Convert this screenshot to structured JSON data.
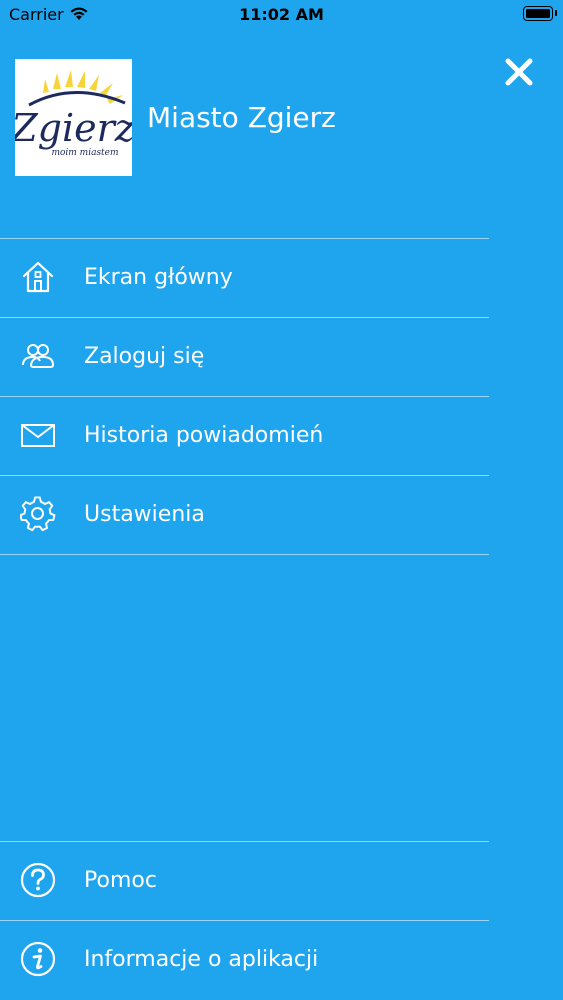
{
  "status_bar": {
    "carrier": "Carrier",
    "time": "11:02 AM"
  },
  "header": {
    "logo_text": "Zgierz",
    "logo_subtext": "moim miastem",
    "title": "Miasto Zgierz"
  },
  "menu": {
    "items": [
      {
        "label": "Ekran główny",
        "icon": "home-icon"
      },
      {
        "label": "Zaloguj się",
        "icon": "users-icon"
      },
      {
        "label": "Historia powiadomień",
        "icon": "envelope-icon"
      },
      {
        "label": "Ustawienia",
        "icon": "gear-icon"
      }
    ]
  },
  "bottom_menu": {
    "items": [
      {
        "label": "Pomoc",
        "icon": "help-icon"
      },
      {
        "label": "Informacje o aplikacji",
        "icon": "info-icon"
      }
    ]
  },
  "colors": {
    "background": "#1fa4ee",
    "text": "#ffffff",
    "logo_navy": "#1d2a5e",
    "logo_sun": "#f7d43a"
  }
}
